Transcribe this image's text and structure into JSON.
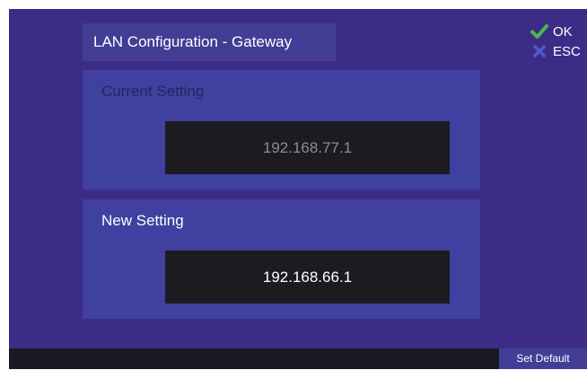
{
  "header": {
    "title": "LAN Configuration - Gateway"
  },
  "actions": {
    "ok_label": "OK",
    "ok_icon": "checkmark-icon",
    "ok_color": "#49b84d",
    "esc_label": "ESC",
    "esc_icon": "x-icon",
    "esc_color": "#4a5fc7"
  },
  "current_setting": {
    "label": "Current Setting",
    "value": "192.168.77.1"
  },
  "new_setting": {
    "label": "New Setting",
    "value": "192.168.66.1"
  },
  "footer": {
    "set_default_label": "Set Default"
  },
  "colors": {
    "background": "#3d2c87",
    "panel": "#3f40a0",
    "title_box": "#423d95",
    "value_box": "#1d1b20",
    "bottom_bar": "#1b1a22"
  }
}
